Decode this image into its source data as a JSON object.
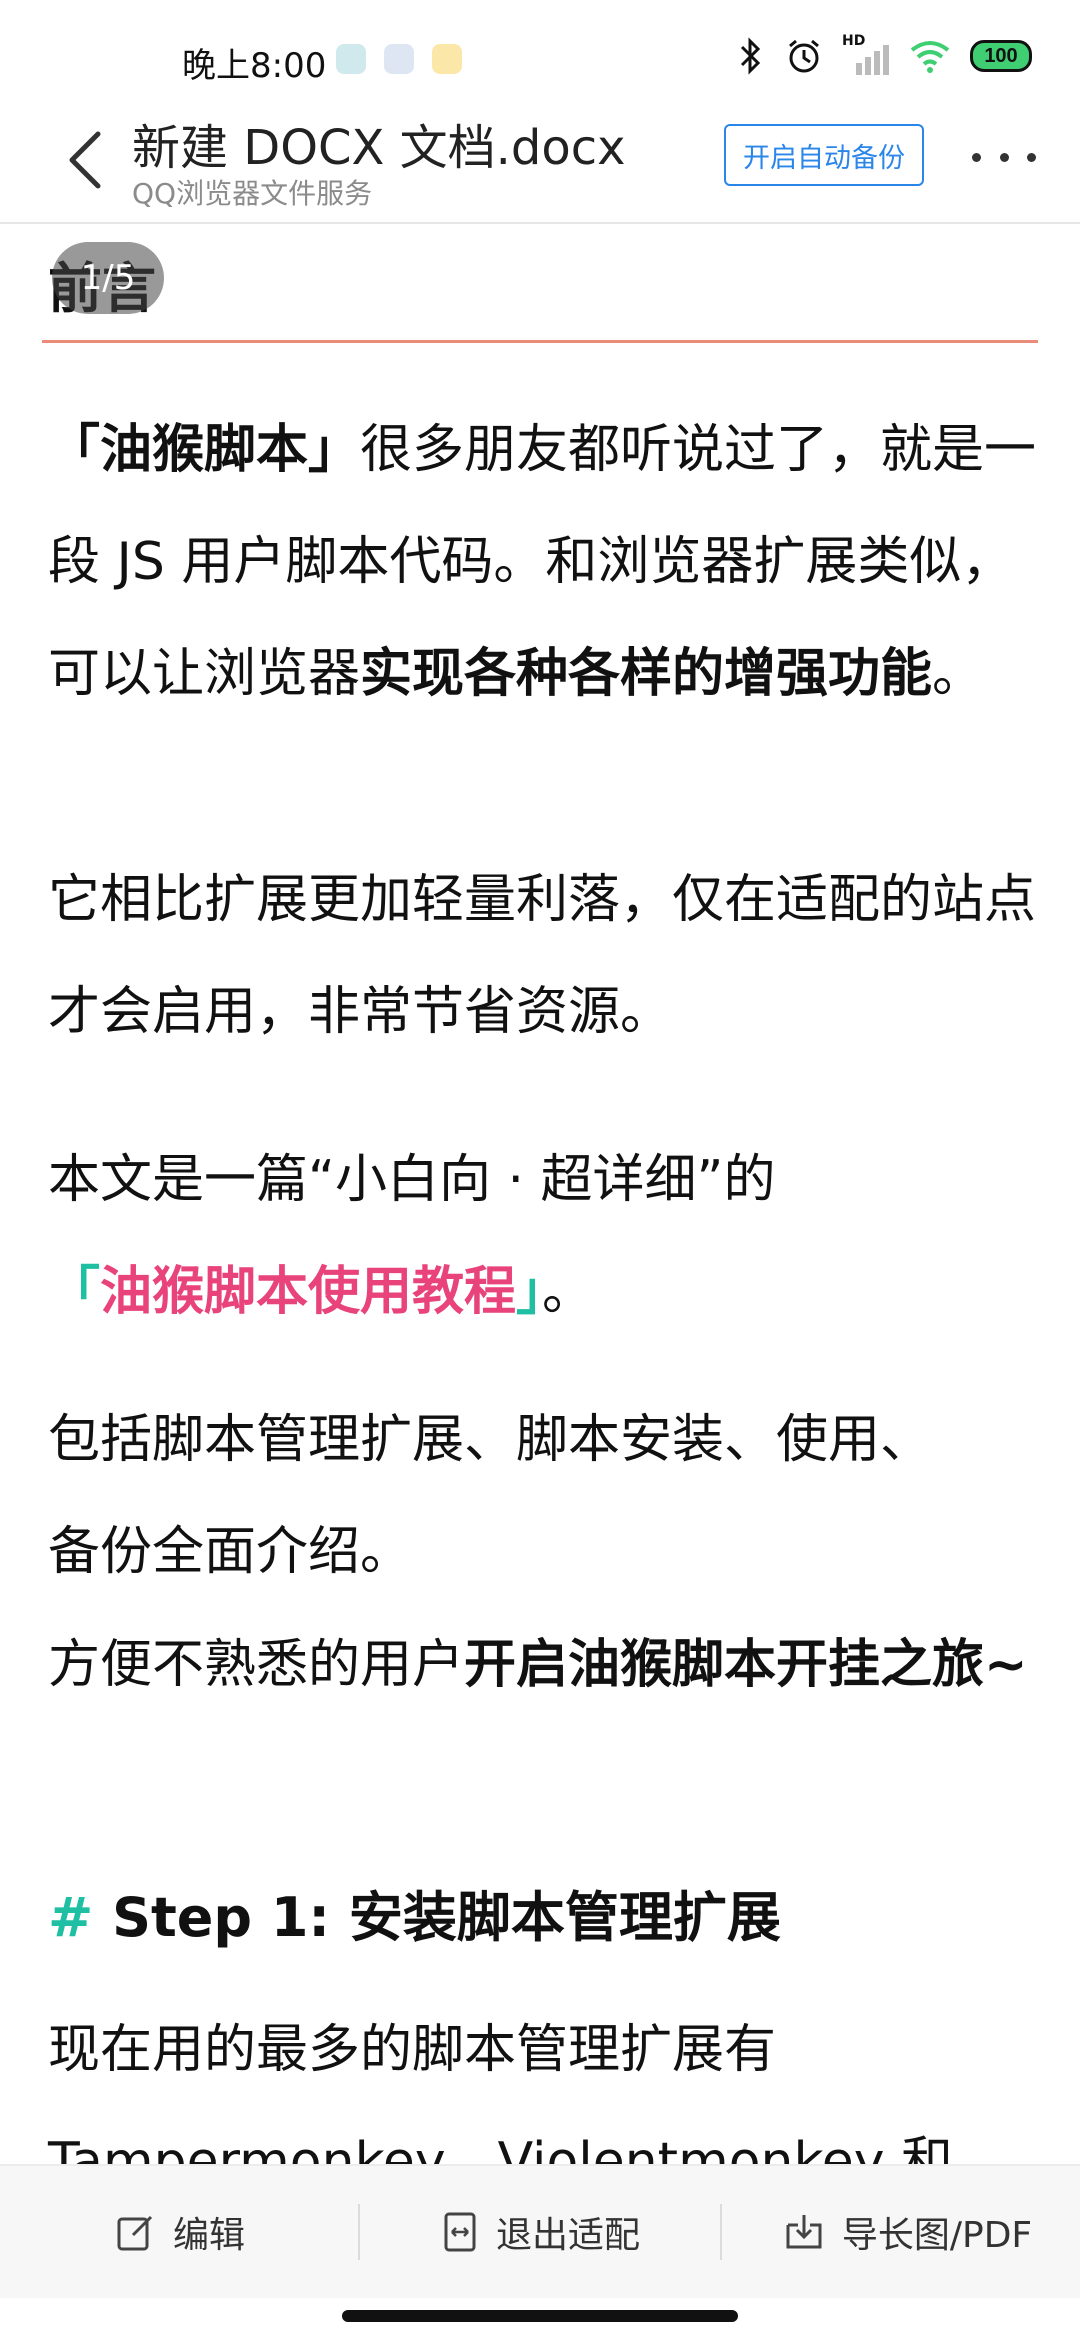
{
  "status_bar": {
    "time": "晚上8:00",
    "battery": "100",
    "network_label": "HD",
    "colors": {
      "battery_fill": "#3fce72"
    }
  },
  "header": {
    "title": "新建 DOCX 文档.docx",
    "subtitle": "QQ浏览器文件服务",
    "backup_button": "开启自动备份",
    "accent": "#2a86e8"
  },
  "document": {
    "page_indicator": "1/5",
    "preface_heading": "前言",
    "p1": {
      "a": "「油猴脚本」",
      "b": "很多朋友都听说过了，就是一段 JS 用户脚本代码。和浏览器扩展类似，可以让浏览器",
      "c": "实现各种各样的增强功能",
      "d": "。"
    },
    "p2": "它相比扩展更加轻量利落，仅在适配的站点才会启用，非常节省资源。",
    "p3": {
      "a": "本文是一篇“小白向 · 超详细”的",
      "bracket_open": "「",
      "highlight": "油猴脚本使用教程",
      "bracket_close": "」",
      "end": "。"
    },
    "p4": "包括脚本管理扩展、脚本安装、使用、备份全面介绍。",
    "p5": {
      "a": "方便不熟悉的用户",
      "b": "开启油猴脚本开挂之旅~"
    },
    "step1": {
      "hash": "#",
      "text": "Step 1: 安装脚本管理扩展"
    },
    "p6": "现在用的最多的脚本管理扩展有 Tampermonkey、Violentmonkey 和",
    "colors": {
      "highlight_pink": "#e8437a",
      "teal": "#1fbfa3",
      "rule_red": "#e98c7a"
    }
  },
  "toolbar": {
    "edit": "编辑",
    "exit_fit": "退出适配",
    "export": "导长图/PDF"
  }
}
